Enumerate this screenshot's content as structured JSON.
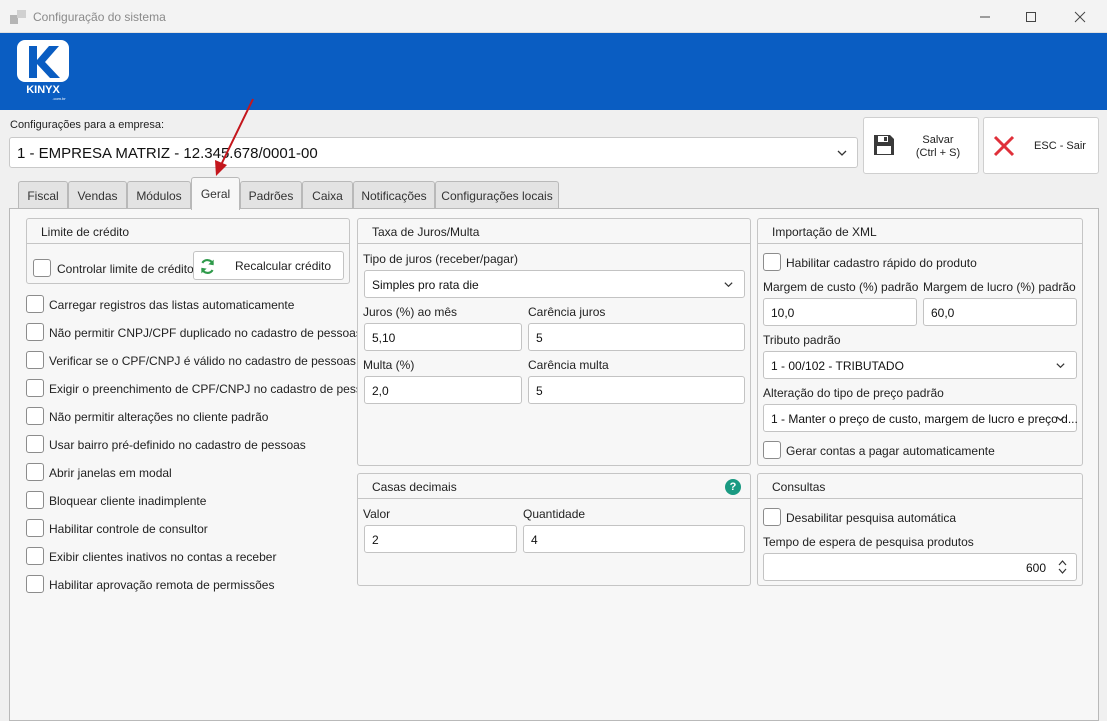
{
  "window": {
    "title": "Configuração do sistema"
  },
  "brand": {
    "name": "KINYX",
    "sub": ".com.br",
    "color": "#0a5dc2"
  },
  "empresa": {
    "label": "Configurações para a empresa:",
    "value": "1 - EMPRESA MATRIZ - 12.345.678/0001-00"
  },
  "actions": {
    "save_label": "Salvar\n(Ctrl + S)",
    "save_line1": "Salvar",
    "save_line2": "(Ctrl + S)",
    "exit_label": "ESC - Sair"
  },
  "tabs": [
    "Fiscal",
    "Vendas",
    "Módulos",
    "Geral",
    "Padrões",
    "Caixa",
    "Notificações",
    "Configurações locais"
  ],
  "active_tab": "Geral",
  "credit": {
    "title": "Limite de crédito",
    "control_label": "Controlar limite de crédito",
    "recalc_label": "Recalcular crédito"
  },
  "options": [
    "Carregar registros das listas automaticamente",
    "Não permitir CNPJ/CPF duplicado no cadastro de pessoas",
    "Verificar se o CPF/CNPJ é válido no cadastro de pessoas",
    "Exigir o preenchimento de CPF/CNPJ no cadastro de pessoas",
    "Não permitir alterações no cliente padrão",
    "Usar bairro pré-definido no cadastro de pessoas",
    "Abrir janelas em modal",
    "Bloquear cliente inadimplente",
    "Habilitar controle de consultor",
    "Exibir clientes inativos no contas a receber",
    "Habilitar aprovação remota de permissões"
  ],
  "juros": {
    "title": "Taxa de Juros/Multa",
    "tipo_label": "Tipo de juros (receber/pagar)",
    "tipo_value": "Simples pro rata die",
    "juros_label": "Juros (%)  ao mês",
    "juros_value": "5,10",
    "carencia_juros_label": "Carência juros",
    "carencia_juros_value": "5",
    "multa_label": "Multa (%)",
    "multa_value": "2,0",
    "carencia_multa_label": "Carência multa",
    "carencia_multa_value": "5"
  },
  "decimais": {
    "title": "Casas decimais",
    "help_icon": "?",
    "valor_label": "Valor",
    "valor_value": "2",
    "quantidade_label": "Quantidade",
    "quantidade_value": "4"
  },
  "xml": {
    "title": "Importação de XML",
    "cadastro_rapido_label": "Habilitar cadastro rápido do produto",
    "margem_custo_label": "Margem de custo (%) padrão",
    "margem_custo_value": "10,0",
    "margem_lucro_label": "Margem de lucro (%) padrão",
    "margem_lucro_value": "60,0",
    "tributo_label": "Tributo padrão",
    "tributo_value": "1 - 00/102 - TRIBUTADO",
    "alteracao_label": "Alteração do tipo de preço padrão",
    "alteracao_value": "1 - Manter o preço de custo, margem de lucro e preço d...",
    "gerar_contas_label": "Gerar contas a pagar automaticamente"
  },
  "consultas": {
    "title": "Consultas",
    "desabilitar_label": "Desabilitar pesquisa automática",
    "tempo_label": "Tempo de espera de pesquisa produtos",
    "tempo_value": "600"
  },
  "colors": {
    "accent": "#0a5dc2",
    "refresh_green": "#2e9a4a",
    "close_red": "#e0303a",
    "help_teal": "#1a9a82",
    "arrow_red": "#c4161c"
  }
}
